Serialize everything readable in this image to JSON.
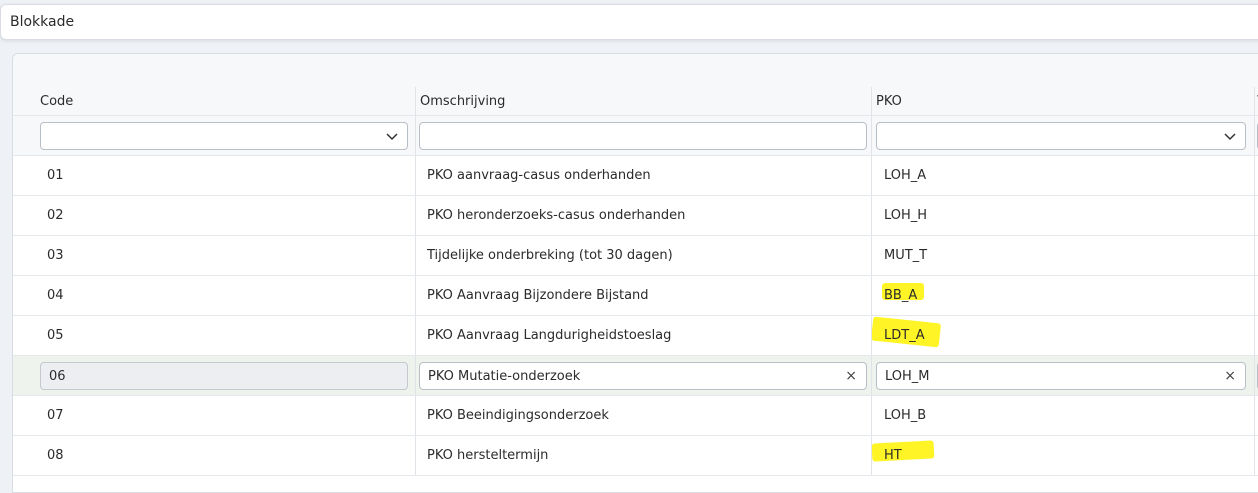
{
  "window": {
    "title": "Blokkade"
  },
  "columns": {
    "code": "Code",
    "omschrijving": "Omschrijving",
    "pko": "PKO",
    "next": "V"
  },
  "filters": {
    "code": "",
    "omschrijving": "",
    "pko": ""
  },
  "rows": [
    {
      "code": "01",
      "omschrijving": "PKO aanvraag-casus onderhanden",
      "pko": "LOH_A",
      "more": "("
    },
    {
      "code": "02",
      "omschrijving": "PKO heronderzoeks-casus onderhanden",
      "pko": "LOH_H",
      "more": "("
    },
    {
      "code": "03",
      "omschrijving": "Tijdelijke onderbreking (tot 30 dagen)",
      "pko": "MUT_T",
      "more": "("
    },
    {
      "code": "04",
      "omschrijving": "PKO Aanvraag Bijzondere Bijstand",
      "pko": "BB_A",
      "more": "("
    },
    {
      "code": "05",
      "omschrijving": "PKO Aanvraag Langdurigheidstoeslag",
      "pko": "LDT_A",
      "more": "("
    },
    {
      "code": "06",
      "omschrijving": "PKO Mutatie-onderzoek",
      "pko": "LOH_M",
      "more": "("
    },
    {
      "code": "07",
      "omschrijving": "PKO Beeindigingsonderzoek",
      "pko": "LOH_B",
      "more": "("
    },
    {
      "code": "08",
      "omschrijving": "PKO hersteltermijn",
      "pko": "HT",
      "more": "("
    }
  ],
  "editing_row": {
    "clear_symbol": "×"
  },
  "icons": {
    "dropdown": "chevron-down-icon",
    "clear": "clear-icon"
  },
  "colors": {
    "highlight": "#fff200",
    "edit_row": "#eef3ee"
  }
}
